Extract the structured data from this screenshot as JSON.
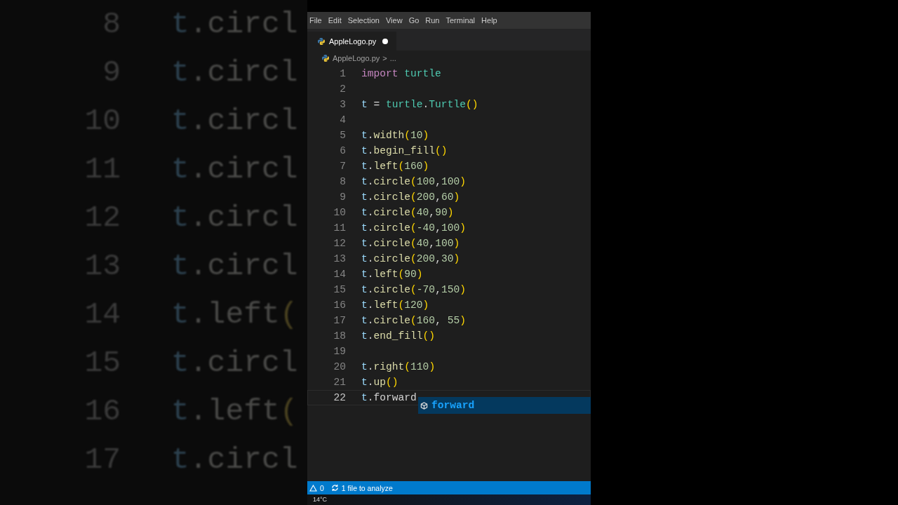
{
  "background_lines": [
    {
      "number": "8",
      "code": [
        {
          "kind": "var",
          "text": "t"
        },
        {
          "kind": "plain",
          "text": ".circl"
        }
      ]
    },
    {
      "number": "9",
      "code": [
        {
          "kind": "var",
          "text": "t"
        },
        {
          "kind": "plain",
          "text": ".circl"
        }
      ]
    },
    {
      "number": "10",
      "code": [
        {
          "kind": "var",
          "text": "t"
        },
        {
          "kind": "plain",
          "text": ".circl"
        }
      ]
    },
    {
      "number": "11",
      "code": [
        {
          "kind": "var",
          "text": "t"
        },
        {
          "kind": "plain",
          "text": ".circl"
        }
      ]
    },
    {
      "number": "12",
      "code": [
        {
          "kind": "var",
          "text": "t"
        },
        {
          "kind": "plain",
          "text": ".circl"
        }
      ]
    },
    {
      "number": "13",
      "code": [
        {
          "kind": "var",
          "text": "t"
        },
        {
          "kind": "plain",
          "text": ".circl"
        }
      ]
    },
    {
      "number": "14",
      "code": [
        {
          "kind": "var",
          "text": "t"
        },
        {
          "kind": "plain",
          "text": ".left"
        },
        {
          "kind": "paren",
          "text": "("
        }
      ]
    },
    {
      "number": "15",
      "code": [
        {
          "kind": "var",
          "text": "t"
        },
        {
          "kind": "plain",
          "text": ".circl"
        }
      ]
    },
    {
      "number": "16",
      "code": [
        {
          "kind": "var",
          "text": "t"
        },
        {
          "kind": "plain",
          "text": ".left"
        },
        {
          "kind": "paren",
          "text": "("
        }
      ]
    },
    {
      "number": "17",
      "code": [
        {
          "kind": "var",
          "text": "t"
        },
        {
          "kind": "plain",
          "text": ".circl"
        }
      ]
    }
  ],
  "menu": [
    "File",
    "Edit",
    "Selection",
    "View",
    "Go",
    "Run",
    "Terminal",
    "Help"
  ],
  "tabs": [
    {
      "label": "AppleLogo.py",
      "selected": true,
      "modified": true
    }
  ],
  "breadcrumb": {
    "file": "AppleLogo.py",
    "separator": ">",
    "rest": "..."
  },
  "lines": [
    {
      "number": "1",
      "current": false,
      "code": [
        {
          "kind": "kw",
          "text": "import "
        },
        {
          "kind": "module",
          "text": "turtle"
        }
      ]
    },
    {
      "number": "2",
      "current": false
    },
    {
      "number": "3",
      "current": false,
      "code": [
        {
          "kind": "var",
          "text": "t"
        },
        {
          "kind": "plain",
          "text": " = "
        },
        {
          "kind": "module",
          "text": "turtle"
        },
        {
          "kind": "plain",
          "text": "."
        },
        {
          "kind": "module",
          "text": "Turtle"
        },
        {
          "kind": "paren",
          "text": "()"
        }
      ]
    },
    {
      "number": "4",
      "current": false
    },
    {
      "number": "5",
      "current": false,
      "code": [
        {
          "kind": "var",
          "text": "t"
        },
        {
          "kind": "plain",
          "text": "."
        },
        {
          "kind": "fn",
          "text": "width"
        },
        {
          "kind": "paren",
          "text": "("
        },
        {
          "kind": "num",
          "text": "10"
        },
        {
          "kind": "paren",
          "text": ")"
        }
      ]
    },
    {
      "number": "6",
      "current": false,
      "code": [
        {
          "kind": "var",
          "text": "t"
        },
        {
          "kind": "plain",
          "text": "."
        },
        {
          "kind": "fn",
          "text": "begin_fill"
        },
        {
          "kind": "paren",
          "text": "()"
        }
      ]
    },
    {
      "number": "7",
      "current": false,
      "code": [
        {
          "kind": "var",
          "text": "t"
        },
        {
          "kind": "plain",
          "text": "."
        },
        {
          "kind": "fn",
          "text": "left"
        },
        {
          "kind": "paren",
          "text": "("
        },
        {
          "kind": "num",
          "text": "160"
        },
        {
          "kind": "paren",
          "text": ")"
        }
      ]
    },
    {
      "number": "8",
      "current": false,
      "code": [
        {
          "kind": "var",
          "text": "t"
        },
        {
          "kind": "plain",
          "text": "."
        },
        {
          "kind": "fn",
          "text": "circle"
        },
        {
          "kind": "paren",
          "text": "("
        },
        {
          "kind": "num",
          "text": "100"
        },
        {
          "kind": "plain",
          "text": ","
        },
        {
          "kind": "num",
          "text": "100"
        },
        {
          "kind": "paren",
          "text": ")"
        }
      ]
    },
    {
      "number": "9",
      "current": false,
      "code": [
        {
          "kind": "var",
          "text": "t"
        },
        {
          "kind": "plain",
          "text": "."
        },
        {
          "kind": "fn",
          "text": "circle"
        },
        {
          "kind": "paren",
          "text": "("
        },
        {
          "kind": "num",
          "text": "200"
        },
        {
          "kind": "plain",
          "text": ","
        },
        {
          "kind": "num",
          "text": "60"
        },
        {
          "kind": "paren",
          "text": ")"
        }
      ]
    },
    {
      "number": "10",
      "current": false,
      "code": [
        {
          "kind": "var",
          "text": "t"
        },
        {
          "kind": "plain",
          "text": "."
        },
        {
          "kind": "fn",
          "text": "circle"
        },
        {
          "kind": "paren",
          "text": "("
        },
        {
          "kind": "num",
          "text": "40"
        },
        {
          "kind": "plain",
          "text": ","
        },
        {
          "kind": "num",
          "text": "90"
        },
        {
          "kind": "paren",
          "text": ")"
        }
      ]
    },
    {
      "number": "11",
      "current": false,
      "code": [
        {
          "kind": "var",
          "text": "t"
        },
        {
          "kind": "plain",
          "text": "."
        },
        {
          "kind": "fn",
          "text": "circle"
        },
        {
          "kind": "paren",
          "text": "("
        },
        {
          "kind": "num",
          "text": "-40"
        },
        {
          "kind": "plain",
          "text": ","
        },
        {
          "kind": "num",
          "text": "100"
        },
        {
          "kind": "paren",
          "text": ")"
        }
      ]
    },
    {
      "number": "12",
      "current": false,
      "code": [
        {
          "kind": "var",
          "text": "t"
        },
        {
          "kind": "plain",
          "text": "."
        },
        {
          "kind": "fn",
          "text": "circle"
        },
        {
          "kind": "paren",
          "text": "("
        },
        {
          "kind": "num",
          "text": "40"
        },
        {
          "kind": "plain",
          "text": ","
        },
        {
          "kind": "num",
          "text": "100"
        },
        {
          "kind": "paren",
          "text": ")"
        }
      ]
    },
    {
      "number": "13",
      "current": false,
      "code": [
        {
          "kind": "var",
          "text": "t"
        },
        {
          "kind": "plain",
          "text": "."
        },
        {
          "kind": "fn",
          "text": "circle"
        },
        {
          "kind": "paren",
          "text": "("
        },
        {
          "kind": "num",
          "text": "200"
        },
        {
          "kind": "plain",
          "text": ","
        },
        {
          "kind": "num",
          "text": "30"
        },
        {
          "kind": "paren",
          "text": ")"
        }
      ]
    },
    {
      "number": "14",
      "current": false,
      "code": [
        {
          "kind": "var",
          "text": "t"
        },
        {
          "kind": "plain",
          "text": "."
        },
        {
          "kind": "fn",
          "text": "left"
        },
        {
          "kind": "paren",
          "text": "("
        },
        {
          "kind": "num",
          "text": "90"
        },
        {
          "kind": "paren",
          "text": ")"
        }
      ]
    },
    {
      "number": "15",
      "current": false,
      "code": [
        {
          "kind": "var",
          "text": "t"
        },
        {
          "kind": "plain",
          "text": "."
        },
        {
          "kind": "fn",
          "text": "circle"
        },
        {
          "kind": "paren",
          "text": "("
        },
        {
          "kind": "num",
          "text": "-70"
        },
        {
          "kind": "plain",
          "text": ","
        },
        {
          "kind": "num",
          "text": "150"
        },
        {
          "kind": "paren",
          "text": ")"
        }
      ]
    },
    {
      "number": "16",
      "current": false,
      "code": [
        {
          "kind": "var",
          "text": "t"
        },
        {
          "kind": "plain",
          "text": "."
        },
        {
          "kind": "fn",
          "text": "left"
        },
        {
          "kind": "paren",
          "text": "("
        },
        {
          "kind": "num",
          "text": "120"
        },
        {
          "kind": "paren",
          "text": ")"
        }
      ]
    },
    {
      "number": "17",
      "current": false,
      "code": [
        {
          "kind": "var",
          "text": "t"
        },
        {
          "kind": "plain",
          "text": "."
        },
        {
          "kind": "fn",
          "text": "circle"
        },
        {
          "kind": "paren",
          "text": "("
        },
        {
          "kind": "num",
          "text": "160"
        },
        {
          "kind": "plain",
          "text": ", "
        },
        {
          "kind": "num",
          "text": "55"
        },
        {
          "kind": "paren",
          "text": ")"
        }
      ]
    },
    {
      "number": "18",
      "current": false,
      "code": [
        {
          "kind": "var",
          "text": "t"
        },
        {
          "kind": "plain",
          "text": "."
        },
        {
          "kind": "fn",
          "text": "end_fill"
        },
        {
          "kind": "paren",
          "text": "()"
        }
      ]
    },
    {
      "number": "19",
      "current": false
    },
    {
      "number": "20",
      "current": false,
      "code": [
        {
          "kind": "var",
          "text": "t"
        },
        {
          "kind": "plain",
          "text": "."
        },
        {
          "kind": "fn",
          "text": "right"
        },
        {
          "kind": "paren",
          "text": "("
        },
        {
          "kind": "num",
          "text": "110"
        },
        {
          "kind": "paren",
          "text": ")"
        }
      ]
    },
    {
      "number": "21",
      "current": false,
      "code": [
        {
          "kind": "var",
          "text": "t"
        },
        {
          "kind": "plain",
          "text": "."
        },
        {
          "kind": "fn",
          "text": "up"
        },
        {
          "kind": "paren",
          "text": "()"
        }
      ]
    },
    {
      "number": "22",
      "current": true,
      "code": [
        {
          "kind": "var",
          "text": "t"
        },
        {
          "kind": "plain",
          "text": ".forward"
        }
      ]
    }
  ],
  "suggestions": [
    {
      "label": "forward",
      "selected": true
    }
  ],
  "status_bar": {
    "problems": "0",
    "analysis": "1 file to analyze"
  },
  "taskbar": {
    "weather": "14°C"
  }
}
